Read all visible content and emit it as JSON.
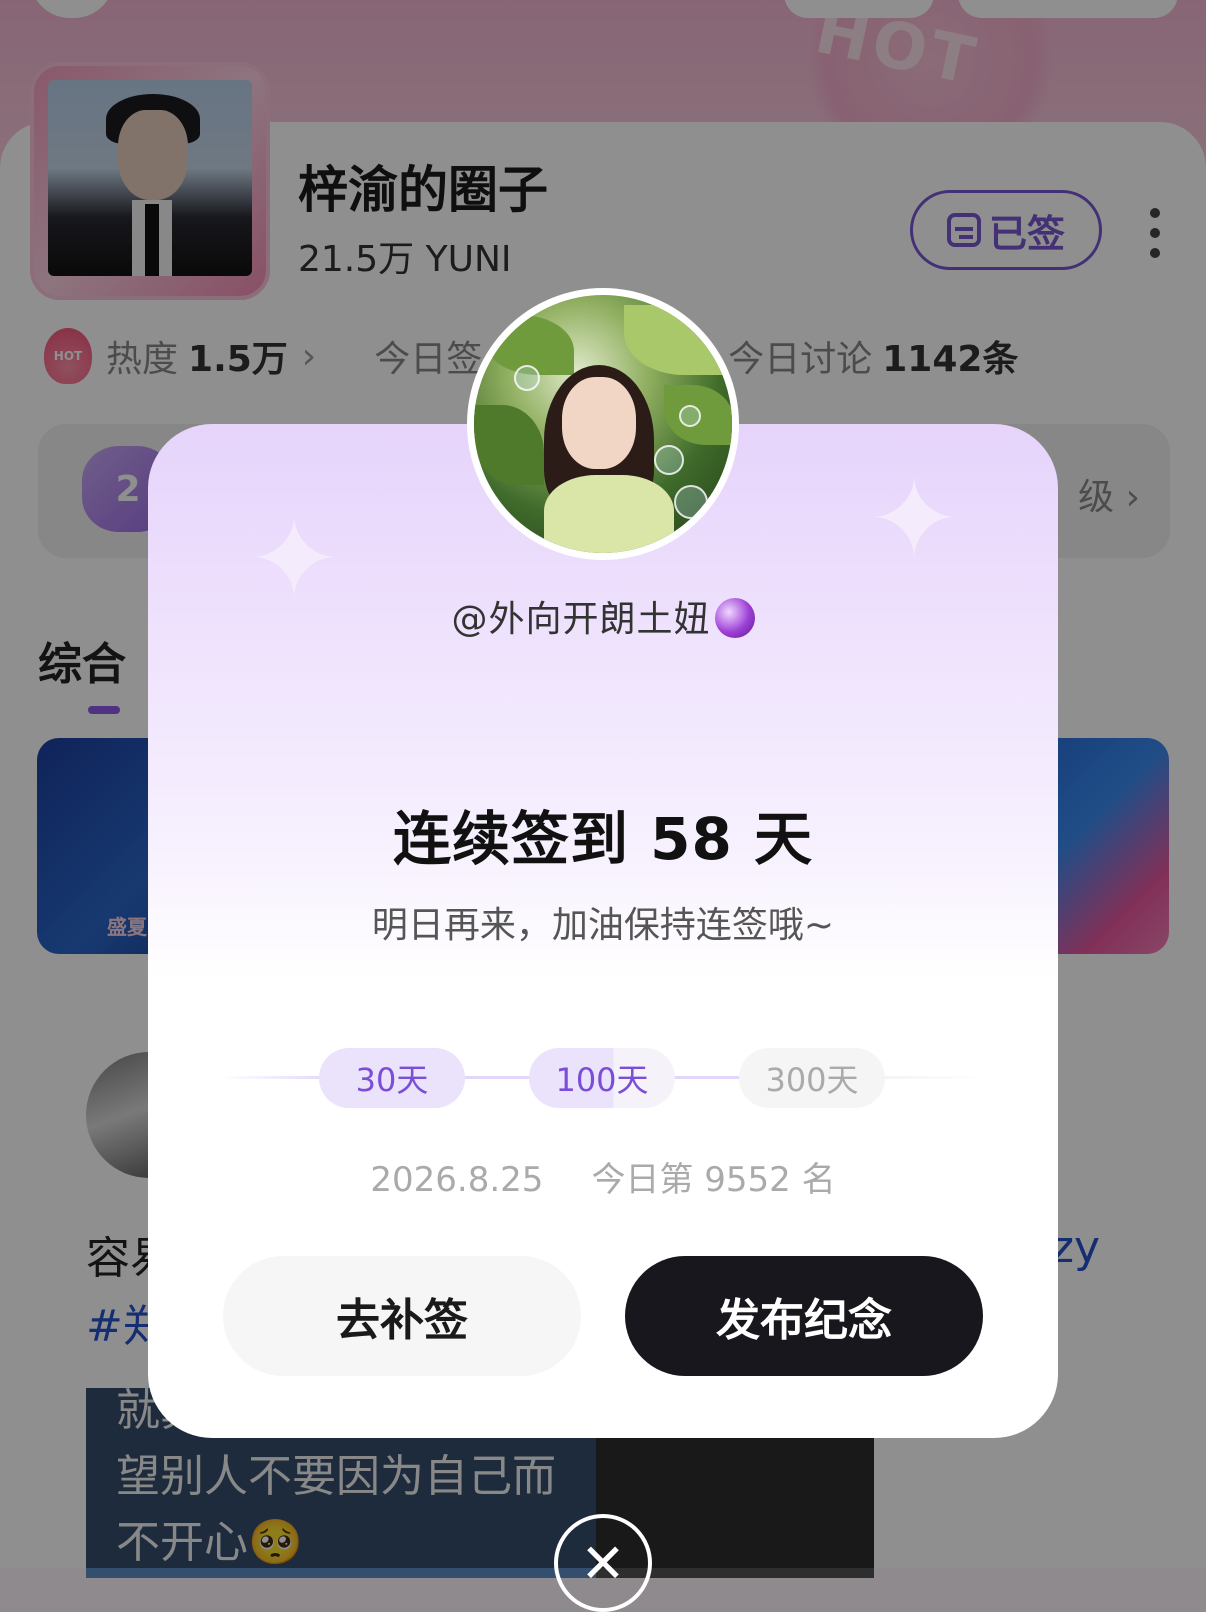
{
  "background": {
    "hot_word": "HOT",
    "circle": {
      "name": "梓渝的圈子",
      "subtitle": "21.5万 YUNI",
      "signed_label": "已签"
    },
    "stats": {
      "heat_label": "热度",
      "heat_value": "1.5万",
      "today_sign_label": "今日签",
      "today_discuss_label": "今日讨论",
      "today_discuss_value": "1142条",
      "flame_text": "HOT"
    },
    "level": {
      "badge": "2",
      "right_text": "级"
    },
    "tab": {
      "label": "综合"
    },
    "banner_left_text": "盛夏",
    "post": {
      "text_start": "容易",
      "tag_start": "#郑",
      "side_text": "zy",
      "image_lines": [
        "就算面对恶意，也是希",
        "望别人不要因为自己而",
        "不开心🥺"
      ]
    }
  },
  "modal": {
    "username": "@外向开朗土妞",
    "title": "连续签到 58 天",
    "subtitle": "明日再来，加油保持连签哦~",
    "milestones": [
      "30天",
      "100天",
      "300天"
    ],
    "milestone_progress": {
      "current_days": 58,
      "reached": [
        "30天"
      ]
    },
    "date": "2026.8.25",
    "rank": "今日第 9552 名",
    "buttons": {
      "makeup": "去补签",
      "publish": "发布纪念"
    },
    "icons": [
      "crystal-ball-icon",
      "close-icon",
      "calendar-icon",
      "more-icon",
      "chevron-right-icon",
      "flame-icon"
    ]
  },
  "colors": {
    "accent_purple": "#7a57d1",
    "button_dark": "#17171d",
    "milestone_bg": "#ebe2fc",
    "link_blue": "#2653c9"
  }
}
